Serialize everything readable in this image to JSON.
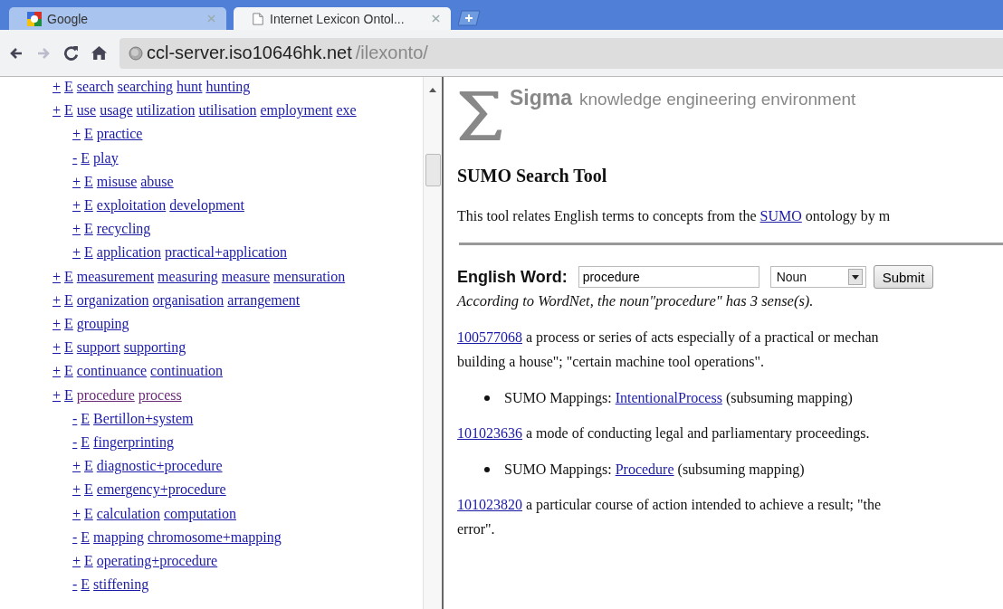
{
  "tabs": [
    {
      "title": "Google",
      "selected": false
    },
    {
      "title": "Internet Lexicon Ontol...",
      "selected": true
    }
  ],
  "address": {
    "host": "ccl-server.iso10646hk.net",
    "path": "/ilexonto/"
  },
  "tree": [
    {
      "toggle": "+",
      "e": "E",
      "words": [
        "search",
        "searching",
        "hunt",
        "hunting"
      ],
      "visited": false
    },
    {
      "toggle": "+",
      "e": "E",
      "words": [
        "use",
        "usage",
        "utilization",
        "utilisation",
        "employment",
        "exe"
      ],
      "visited": false,
      "children": [
        {
          "toggle": "+",
          "e": "E",
          "words": [
            "practice"
          ],
          "visited": false
        },
        {
          "toggle": "-",
          "e": "E",
          "words": [
            "play"
          ],
          "visited": false
        },
        {
          "toggle": "+",
          "e": "E",
          "words": [
            "misuse",
            "abuse"
          ],
          "visited": false
        },
        {
          "toggle": "+",
          "e": "E",
          "words": [
            "exploitation",
            "development"
          ],
          "visited": false
        },
        {
          "toggle": "+",
          "e": "E",
          "words": [
            "recycling"
          ],
          "visited": false
        },
        {
          "toggle": "+",
          "e": "E",
          "words": [
            "application",
            "practical+application"
          ],
          "visited": false
        }
      ]
    },
    {
      "toggle": "+",
      "e": "E",
      "words": [
        "measurement",
        "measuring",
        "measure",
        "mensuration"
      ],
      "visited": false
    },
    {
      "toggle": "+",
      "e": "E",
      "words": [
        "organization",
        "organisation",
        "arrangement"
      ],
      "visited": false
    },
    {
      "toggle": "+",
      "e": "E",
      "words": [
        "grouping"
      ],
      "visited": false
    },
    {
      "toggle": "+",
      "e": "E",
      "words": [
        "support",
        "supporting"
      ],
      "visited": false
    },
    {
      "toggle": "+",
      "e": "E",
      "words": [
        "continuance",
        "continuation"
      ],
      "visited": false
    },
    {
      "toggle": "+",
      "e": "E",
      "words": [
        "procedure",
        "process"
      ],
      "visited": true,
      "children": [
        {
          "toggle": "-",
          "e": "E",
          "words": [
            "Bertillon+system"
          ],
          "visited": false
        },
        {
          "toggle": "-",
          "e": "E",
          "words": [
            "fingerprinting"
          ],
          "visited": false
        },
        {
          "toggle": "+",
          "e": "E",
          "words": [
            "diagnostic+procedure"
          ],
          "visited": false
        },
        {
          "toggle": "+",
          "e": "E",
          "words": [
            "emergency+procedure"
          ],
          "visited": false
        },
        {
          "toggle": "+",
          "e": "E",
          "words": [
            "calculation",
            "computation"
          ],
          "visited": false
        },
        {
          "toggle": "-",
          "e": "E",
          "words": [
            "mapping",
            "chromosome+mapping"
          ],
          "visited": false
        },
        {
          "toggle": "+",
          "e": "E",
          "words": [
            "operating+procedure"
          ],
          "visited": false
        },
        {
          "toggle": "-",
          "e": "E",
          "words": [
            "stiffening"
          ],
          "visited": false
        }
      ]
    }
  ],
  "brand": {
    "name": "Sigma",
    "tagline": "knowledge engineering environment"
  },
  "heading": "SUMO Search Tool",
  "intro": {
    "before": "This tool relates English terms to concepts from the",
    "link": "SUMO",
    "after": "ontology by m"
  },
  "form": {
    "label": "English Word:",
    "value": "procedure",
    "pos": "Noun",
    "submit": "Submit"
  },
  "summary": "According to WordNet, the noun\"procedure\" has 3 sense(s).",
  "senses": [
    {
      "id": "100577068",
      "lines": [
        "a process or series of acts especially of a practical or mechan",
        "building a house\"; \"certain machine tool operations\"."
      ],
      "mapping": {
        "label": "SUMO Mappings:",
        "link": "IntentionalProcess",
        "note": "(subsuming mapping)"
      }
    },
    {
      "id": "101023636",
      "lines": [
        "a mode of conducting legal and parliamentary proceedings."
      ],
      "mapping": {
        "label": "SUMO Mappings:",
        "link": "Procedure",
        "note": "(subsuming mapping)"
      }
    },
    {
      "id": "101023820",
      "lines": [
        "a particular course of action intended to achieve a result; \"the",
        "error\"."
      ]
    }
  ]
}
